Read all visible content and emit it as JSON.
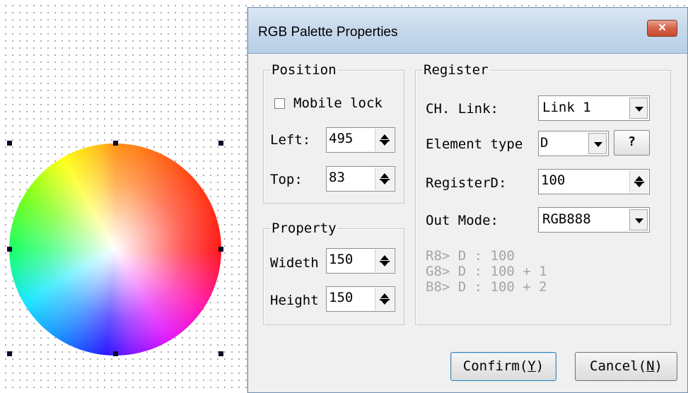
{
  "dialog": {
    "title": "RGB Palette Properties",
    "close_label": "✕"
  },
  "position": {
    "legend": "Position",
    "mobile_lock_label": "Mobile lock",
    "mobile_lock_checked": false,
    "left_label": "Left:",
    "left_value": "495",
    "top_label": "Top:",
    "top_value": "83"
  },
  "property": {
    "legend": "Property",
    "width_label": "Wideth",
    "width_value": "150",
    "height_label": "Height",
    "height_value": "150"
  },
  "register": {
    "legend": "Register",
    "ch_link_label": "CH. Link:",
    "ch_link_value": "Link 1",
    "element_type_label": "Element type",
    "element_type_value": "D",
    "help_label": "?",
    "register_label": "RegisterD:",
    "register_value": "100",
    "out_mode_label": "Out Mode:",
    "out_mode_value": "RGB888",
    "info_lines": [
      "R8> D : 100",
      "G8> D : 100 + 1",
      "B8> D : 100 + 2"
    ]
  },
  "buttons": {
    "confirm_prefix": "Confirm(",
    "confirm_key": "Y",
    "confirm_suffix": ")",
    "cancel_prefix": "Cancel(",
    "cancel_key": "N",
    "cancel_suffix": ")"
  }
}
